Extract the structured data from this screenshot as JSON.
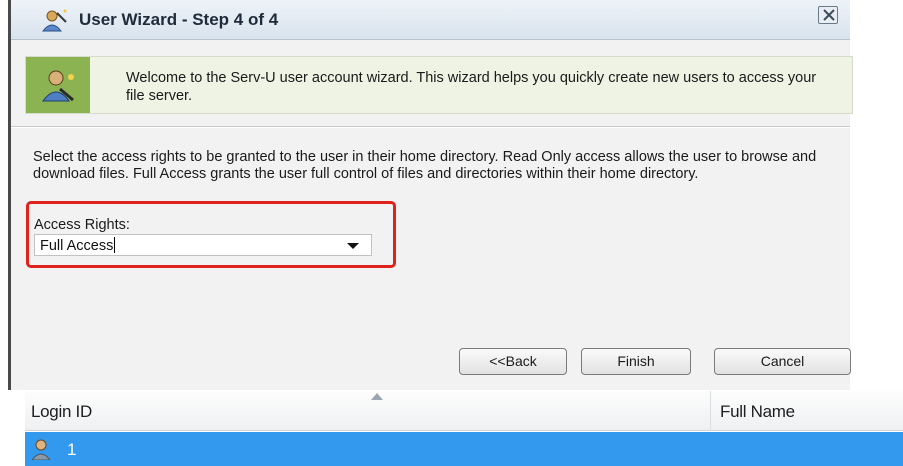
{
  "dialog": {
    "title": "User Wizard - Step 4 of 4",
    "banner_text": "Welcome to the Serv-U user account wizard. This wizard helps you quickly create new users to access your file server.",
    "instructions": "Select the access rights to be granted to the user in their home directory. Read Only access allows the user to browse and download files. Full Access grants the user full control of files and directories within their home directory.",
    "access_rights": {
      "label": "Access Rights:",
      "value": "Full Access"
    },
    "buttons": {
      "back": "<<Back",
      "finish": "Finish",
      "cancel": "Cancel"
    },
    "icons": {
      "title": "wizard-icon",
      "close": "close-icon",
      "banner": "user-wizard-icon",
      "dropdown": "chevron-down-icon"
    }
  },
  "user_grid": {
    "columns": [
      "Login ID",
      "Full Name"
    ],
    "rows": [
      {
        "login_id": "1",
        "full_name": ""
      }
    ],
    "sort_icon": "sort-ascending-icon",
    "row_icon": "user-icon"
  },
  "colors": {
    "highlight": "#e0221c",
    "selected_row": "#3399ee",
    "banner_icon_bg": "#8bb352"
  }
}
